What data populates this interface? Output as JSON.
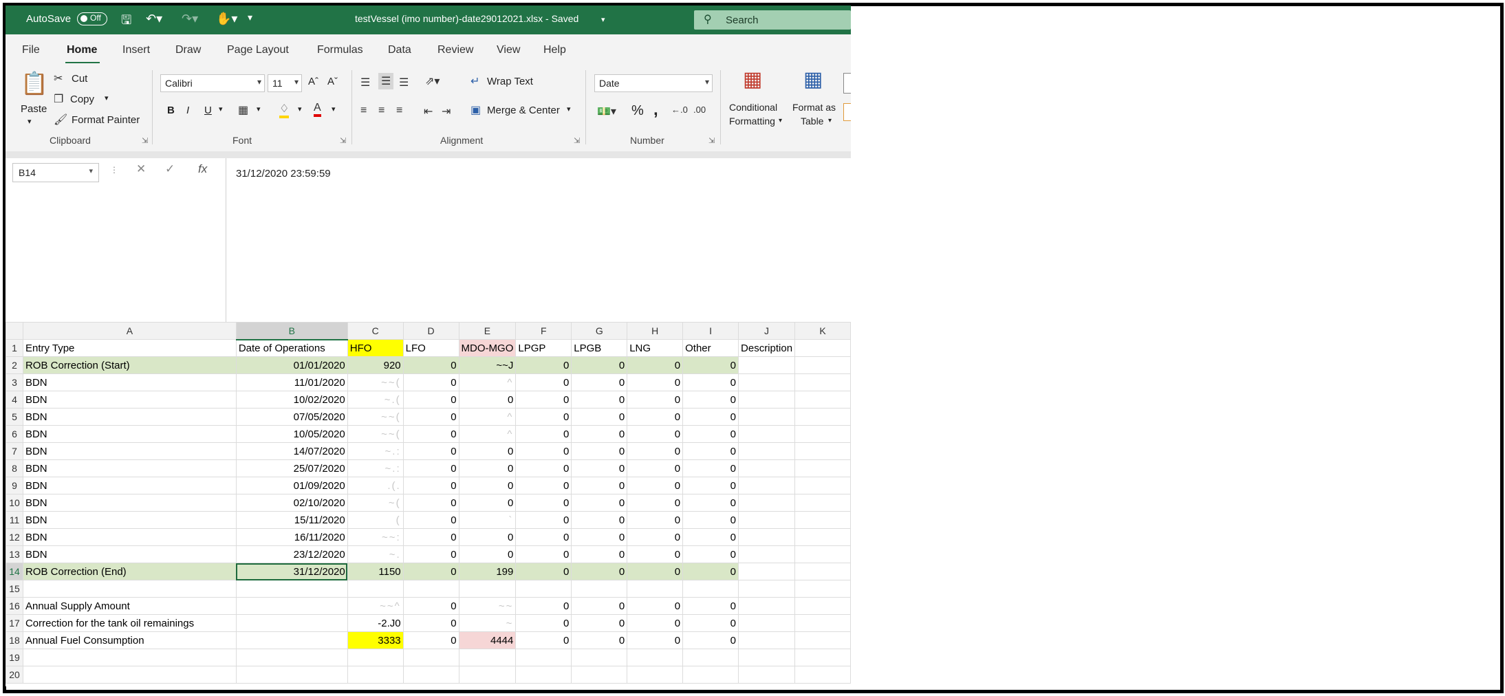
{
  "titlebar": {
    "autosave_label": "AutoSave",
    "autosave_state": "Off",
    "document_title": "testVessel (imo number)-date29012021.xlsx - Saved",
    "search_placeholder": "Search",
    "qa_icons": [
      "save-icon",
      "undo-icon",
      "redo-icon",
      "touch-mode-icon",
      "customize-icon"
    ]
  },
  "tabs": [
    "File",
    "Home",
    "Insert",
    "Draw",
    "Page Layout",
    "Formulas",
    "Data",
    "Review",
    "View",
    "Help"
  ],
  "active_tab": "Home",
  "ribbon": {
    "clipboard": {
      "paste": "Paste",
      "cut": "Cut",
      "copy": "Copy",
      "format_painter": "Format Painter",
      "label": "Clipboard"
    },
    "font": {
      "name": "Calibri",
      "size": "11",
      "bold": "B",
      "italic": "I",
      "underline": "U",
      "label": "Font"
    },
    "alignment": {
      "wrap_text": "Wrap Text",
      "merge_center": "Merge & Center",
      "label": "Alignment"
    },
    "number": {
      "format": "Date",
      "percent": "%",
      "comma": ",",
      "label": "Number"
    },
    "styles": {
      "conditional": "Conditional",
      "conditional2": "Formatting",
      "format_as": "Format as",
      "format_as2": "Table"
    }
  },
  "formula_bar": {
    "name_box": "B14",
    "formula": "31/12/2020  23:59:59"
  },
  "grid": {
    "columns": [
      "A",
      "B",
      "C",
      "D",
      "E",
      "F",
      "G",
      "H",
      "I",
      "J",
      "K"
    ],
    "selected_column": "B",
    "selected_row": "14",
    "rows": [
      {
        "n": "1",
        "cells": [
          "Entry Type",
          "Date of Operations",
          "HFO",
          "LFO",
          "MDO-MGO",
          "LPGP",
          "LPGB",
          "LNG",
          "Other",
          "Description",
          ""
        ]
      },
      {
        "n": "2",
        "cells": [
          "ROB Correction (Start)",
          "01/01/2020",
          "920",
          "0",
          "~~J",
          "0",
          "0",
          "0",
          "0",
          "",
          ""
        ]
      },
      {
        "n": "3",
        "cells": [
          "BDN",
          "11/01/2020",
          "~~(",
          "0",
          "^",
          "0",
          "0",
          "0",
          "0",
          "",
          ""
        ]
      },
      {
        "n": "4",
        "cells": [
          "BDN",
          "10/02/2020",
          "~.(",
          "0",
          "0",
          "0",
          "0",
          "0",
          "0",
          "",
          ""
        ]
      },
      {
        "n": "5",
        "cells": [
          "BDN",
          "07/05/2020",
          "~~(",
          "0",
          "^",
          "0",
          "0",
          "0",
          "0",
          "",
          ""
        ]
      },
      {
        "n": "6",
        "cells": [
          "BDN",
          "10/05/2020",
          "~~(",
          "0",
          "^",
          "0",
          "0",
          "0",
          "0",
          "",
          ""
        ]
      },
      {
        "n": "7",
        "cells": [
          "BDN",
          "14/07/2020",
          "~.:",
          "0",
          "0",
          "0",
          "0",
          "0",
          "0",
          "",
          ""
        ]
      },
      {
        "n": "8",
        "cells": [
          "BDN",
          "25/07/2020",
          "~.:",
          "0",
          "0",
          "0",
          "0",
          "0",
          "0",
          "",
          ""
        ]
      },
      {
        "n": "9",
        "cells": [
          "BDN",
          "01/09/2020",
          ".(.",
          "0",
          "0",
          "0",
          "0",
          "0",
          "0",
          "",
          ""
        ]
      },
      {
        "n": "10",
        "cells": [
          "BDN",
          "02/10/2020",
          "~(",
          "0",
          "0",
          "0",
          "0",
          "0",
          "0",
          "",
          ""
        ]
      },
      {
        "n": "11",
        "cells": [
          "BDN",
          "15/11/2020",
          "(",
          "0",
          "`",
          "0",
          "0",
          "0",
          "0",
          "",
          ""
        ]
      },
      {
        "n": "12",
        "cells": [
          "BDN",
          "16/11/2020",
          "~~:",
          "0",
          "0",
          "0",
          "0",
          "0",
          "0",
          "",
          ""
        ]
      },
      {
        "n": "13",
        "cells": [
          "BDN",
          "23/12/2020",
          "~.",
          "0",
          "0",
          "0",
          "0",
          "0",
          "0",
          "",
          ""
        ]
      },
      {
        "n": "14",
        "cells": [
          "ROB Correction (End)",
          "31/12/2020",
          "1150",
          "0",
          "199",
          "0",
          "0",
          "0",
          "0",
          "",
          ""
        ]
      },
      {
        "n": "15",
        "cells": [
          "",
          "",
          "",
          "",
          "",
          "",
          "",
          "",
          "",
          "",
          ""
        ]
      },
      {
        "n": "16",
        "cells": [
          "Annual Supply Amount",
          "",
          "~~^",
          "0",
          "~~",
          "0",
          "0",
          "0",
          "0",
          "",
          ""
        ]
      },
      {
        "n": "17",
        "cells": [
          "Correction for the tank oil remainings",
          "",
          "-2.J0",
          "0",
          "~",
          "0",
          "0",
          "0",
          "0",
          "",
          ""
        ]
      },
      {
        "n": "18",
        "cells": [
          "Annual Fuel Consumption",
          "",
          "3333",
          "0",
          "4444",
          "0",
          "0",
          "0",
          "0",
          "",
          ""
        ]
      },
      {
        "n": "19",
        "cells": [
          "",
          "",
          "",
          "",
          "",
          "",
          "",
          "",
          "",
          "",
          ""
        ]
      },
      {
        "n": "20",
        "cells": [
          "",
          "",
          "",
          "",
          "",
          "",
          "",
          "",
          "",
          "",
          ""
        ]
      }
    ]
  },
  "colors": {
    "excel_green": "#217346",
    "row_highlight": "#d9e7c7",
    "hfo_highlight": "#ffff00",
    "mdo_highlight": "#f6d6d6"
  }
}
